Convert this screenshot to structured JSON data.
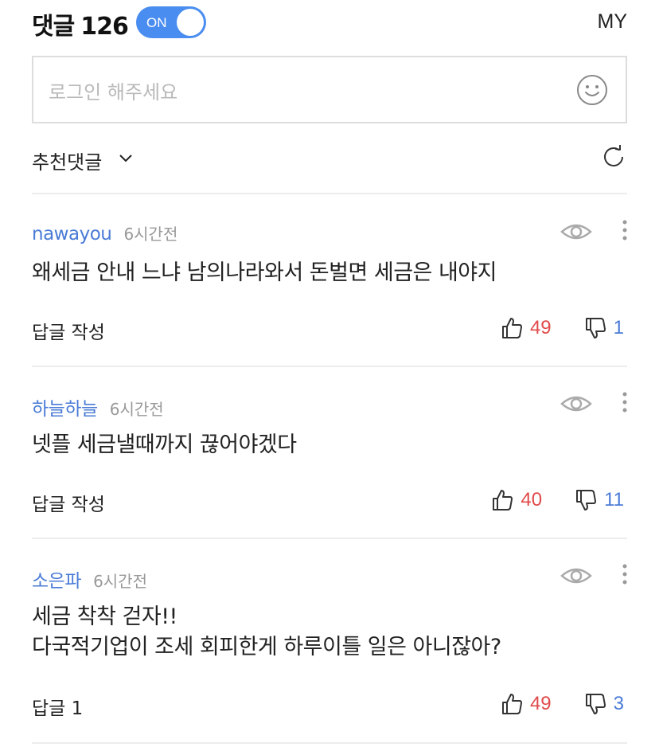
{
  "header": {
    "title": "댓글",
    "count": "126",
    "toggle_label": "ON",
    "my_label": "MY"
  },
  "input": {
    "placeholder": "로그인 해주세요",
    "emoji_icon": "smiley-icon"
  },
  "sort": {
    "label": "추천댓글",
    "dropdown_icon": "chevron-down-icon",
    "refresh_icon": "refresh-icon"
  },
  "colors": {
    "accent": "#4a8df0",
    "author": "#4a7bd6",
    "like": "#e04b4b",
    "dislike": "#4a7bd6"
  },
  "comments": [
    {
      "author": "nawayou",
      "time": "6시간전",
      "lines": [
        "왜세금  안내 느냐  남의나라와서  돈벌면  세금은 내야지"
      ],
      "reply": "답글 작성",
      "likes": "49",
      "dislikes": "1"
    },
    {
      "author": "하늘하늘",
      "time": "6시간전",
      "lines": [
        "넷플 세금낼때까지 끊어야겠다"
      ],
      "reply": "답글 작성",
      "likes": "40",
      "dislikes": "11"
    },
    {
      "author": "소은파",
      "time": "6시간전",
      "lines": [
        "세금 착착 걷자!!",
        "다국적기업이 조세 회피한게 하루이틀 일은 아니잖아?"
      ],
      "reply": "답글 1",
      "likes": "49",
      "dislikes": "3"
    }
  ]
}
